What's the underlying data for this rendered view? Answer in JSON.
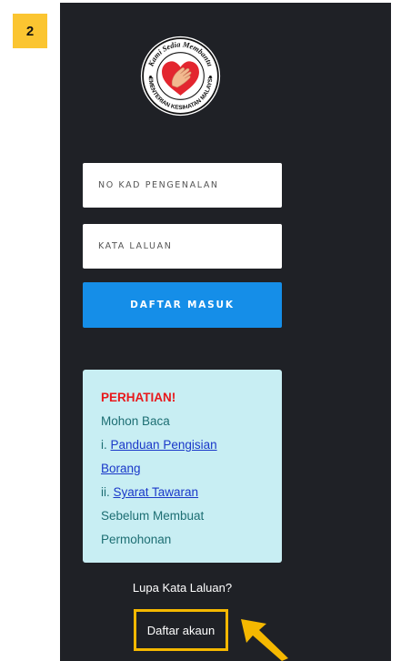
{
  "step": {
    "number": "2"
  },
  "logo": {
    "ring_top_text": "Kami Sedia Membantu",
    "ring_bottom_text": "KEMENTERIAN KESIHATAN MALAYSIA"
  },
  "form": {
    "ic_placeholder": "NO KAD PENGENALAN",
    "password_placeholder": "KATA LALUAN",
    "login_label": "DAFTAR MASUK"
  },
  "notice": {
    "title": "PERHATIAN!",
    "line1": "Mohon Baca",
    "item1_prefix": "i. ",
    "item1_link_part1": "Panduan Pengisian",
    "item1_link_part2": "Borang",
    "item2_prefix": "ii. ",
    "item2_link": "Syarat Tawaran",
    "line_end1": "Sebelum Membuat",
    "line_end2": "Permohonan"
  },
  "links": {
    "forgot_password": "Lupa Kata Laluan?",
    "register": "Daftar akaun"
  },
  "colors": {
    "panel_bg": "#1f2126",
    "primary_button": "#158ee8",
    "notice_bg": "#c8eef3",
    "warning_text": "#e8191c",
    "highlight": "#f5b800",
    "badge": "#fbc531"
  }
}
